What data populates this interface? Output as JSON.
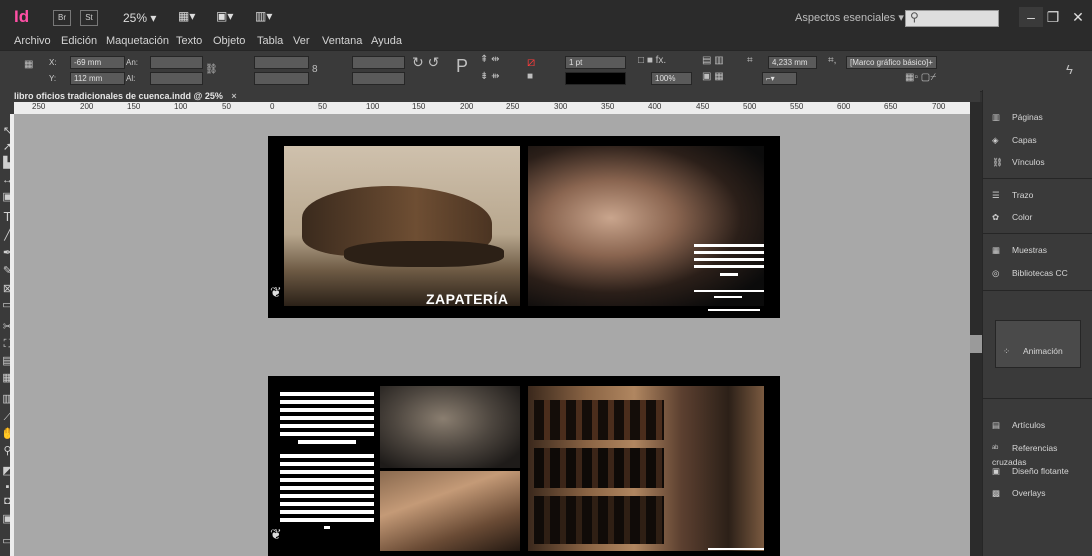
{
  "app": {
    "logo": "Id",
    "bridge": "Br",
    "stock": "St",
    "zoom": "25% ▾",
    "workspace": "Aspectos esenciales ▾",
    "search_icon": "⚲"
  },
  "menu": [
    "Archivo",
    "Edición",
    "Maquetación",
    "Texto",
    "Objeto",
    "Tabla",
    "Ver",
    "Ventana",
    "Ayuda"
  ],
  "control": {
    "x_label": "X:",
    "x_value": "-69 mm",
    "y_label": "Y:",
    "y_value": "112 mm",
    "w_label": "An:",
    "h_label": "Al:",
    "stroke": "1 pt",
    "opacity": "100%",
    "size": "4,233 mm",
    "frame_style": "[Marco gráfico básico]+"
  },
  "document": {
    "tab": "libro oficios tradicionales de cuenca.indd @ 25%",
    "close": "×"
  },
  "ruler": [
    "250",
    "200",
    "150",
    "100",
    "50",
    "0",
    "50",
    "100",
    "150",
    "200",
    "250",
    "300",
    "350",
    "400",
    "450",
    "500",
    "550",
    "600",
    "650",
    "700"
  ],
  "spread1": {
    "caption": "ZAPATERÍA"
  },
  "panels": [
    {
      "label": "Páginas",
      "icon": "pages-icon"
    },
    {
      "label": "Capas",
      "icon": "layers-icon"
    },
    {
      "label": "Vínculos",
      "icon": "links-icon"
    },
    {
      "label": "Trazo",
      "icon": "stroke-icon"
    },
    {
      "label": "Color",
      "icon": "color-icon"
    },
    {
      "label": "Muestras",
      "icon": "swatches-icon"
    },
    {
      "label": "Bibliotecas CC",
      "icon": "cc-libraries-icon"
    },
    {
      "label": "Animación",
      "icon": "animation-icon"
    },
    {
      "label": "Artículos",
      "icon": "articles-icon"
    },
    {
      "label": "Referencias cruzadas",
      "icon": "cross-references-icon"
    },
    {
      "label": "Diseño flotante",
      "icon": "liquid-layout-icon"
    },
    {
      "label": "Overlays",
      "icon": "overlays-icon"
    }
  ]
}
